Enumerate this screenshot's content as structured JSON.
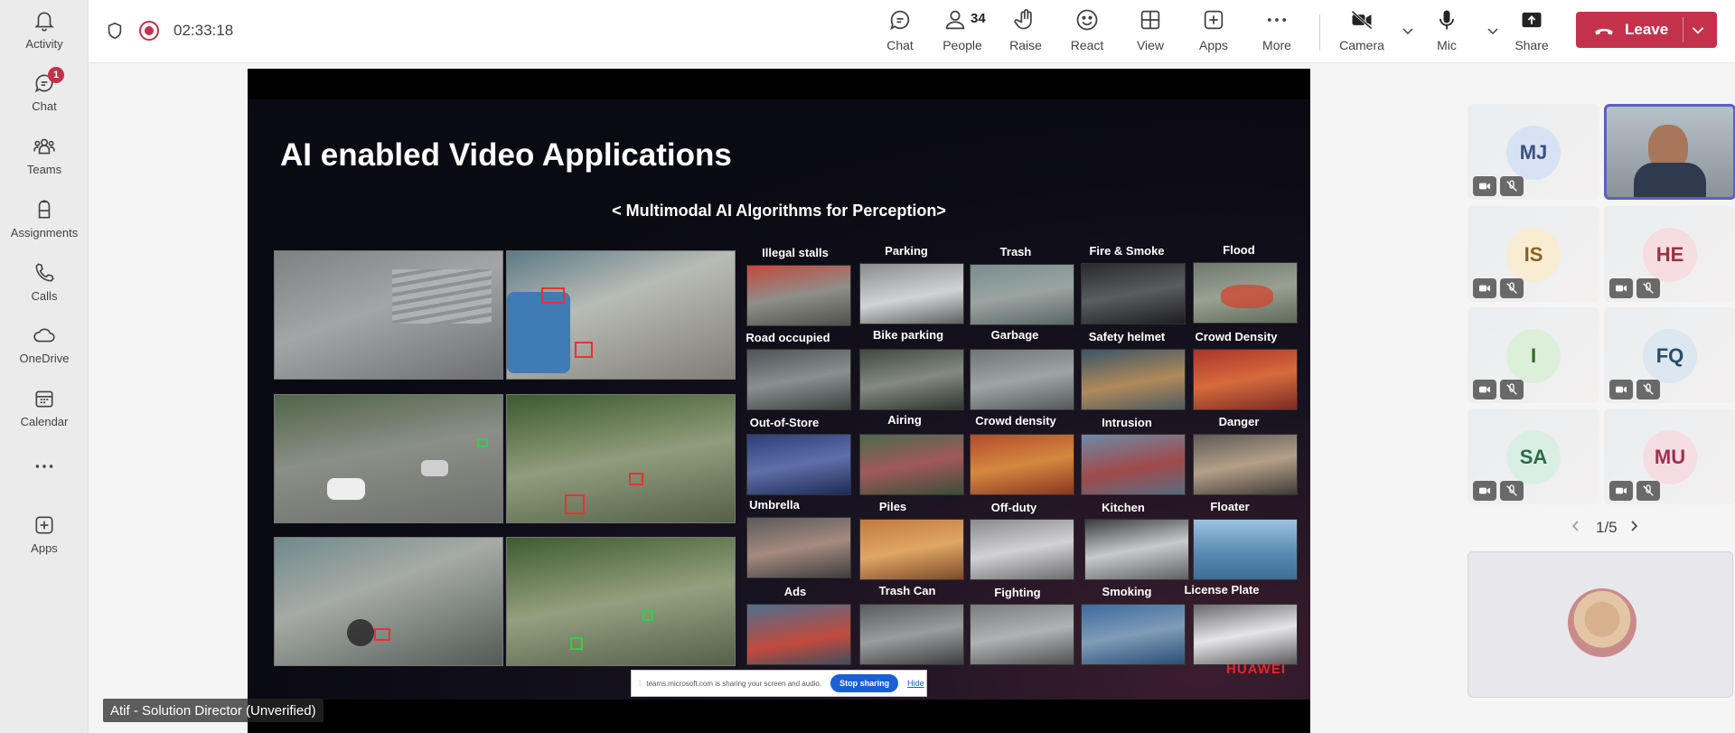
{
  "rail": {
    "items": [
      {
        "label": "Activity",
        "icon": "bell-icon"
      },
      {
        "label": "Chat",
        "icon": "chat-icon",
        "badge": "1"
      },
      {
        "label": "Teams",
        "icon": "teams-icon"
      },
      {
        "label": "Assignments",
        "icon": "assignments-icon"
      },
      {
        "label": "Calls",
        "icon": "phone-icon"
      },
      {
        "label": "OneDrive",
        "icon": "cloud-icon"
      },
      {
        "label": "Calendar",
        "icon": "calendar-icon"
      },
      {
        "label": "",
        "icon": "more-icon"
      },
      {
        "label": "Apps",
        "icon": "apps-plus-icon"
      }
    ]
  },
  "topbar": {
    "timer": "02:33:18",
    "buttons": {
      "chat": "Chat",
      "people": "People",
      "people_count": "34",
      "raise": "Raise",
      "react": "React",
      "view": "View",
      "apps": "Apps",
      "more": "More",
      "camera": "Camera",
      "mic": "Mic",
      "share": "Share"
    },
    "leave": "Leave",
    "colors": {
      "leave": "#c4314b",
      "recording": "#c4314b"
    }
  },
  "slide": {
    "title": "AI enabled Video Applications",
    "subtitle": "< Multimodal AI Algorithms for Perception>",
    "categories": [
      "Illegal stalls",
      "Parking",
      "Trash",
      "Fire & Smoke",
      "Flood",
      "Road occupied",
      "Bike parking",
      "Garbage",
      "Safety helmet",
      "Crowd Density",
      "Out-of-Store",
      "Airing",
      "Crowd density",
      "Intrusion",
      "Danger",
      "Umbrella",
      "Piles",
      "Off-duty",
      "Kitchen",
      "Floater",
      "Ads",
      "Trash Can",
      "Fighting",
      "Smoking",
      "License Plate"
    ],
    "brand": "HUAWEI"
  },
  "sharing_bar": {
    "message": "teams.microsoft.com is sharing your screen and audio.",
    "stop": "Stop sharing",
    "hide": "Hide"
  },
  "presenter_label": "Atif - Solution Director (Unverified)",
  "participants": [
    {
      "initials": "MJ",
      "bg": "#d7e3f5",
      "fg": "#3c4f80"
    },
    {
      "initials": "",
      "video": true
    },
    {
      "initials": "IS",
      "bg": "#f8ecd3",
      "fg": "#8a6220"
    },
    {
      "initials": "HE",
      "bg": "#f6dde0",
      "fg": "#9b3140"
    },
    {
      "initials": "I",
      "bg": "#dcefd9",
      "fg": "#2d6b2a"
    },
    {
      "initials": "FQ",
      "bg": "#dce7ef",
      "fg": "#2b4c66"
    },
    {
      "initials": "SA",
      "bg": "#d9efe4",
      "fg": "#2a6b49"
    },
    {
      "initials": "MU",
      "bg": "#f6dde4",
      "fg": "#9b3152"
    }
  ],
  "pager": "1/5"
}
